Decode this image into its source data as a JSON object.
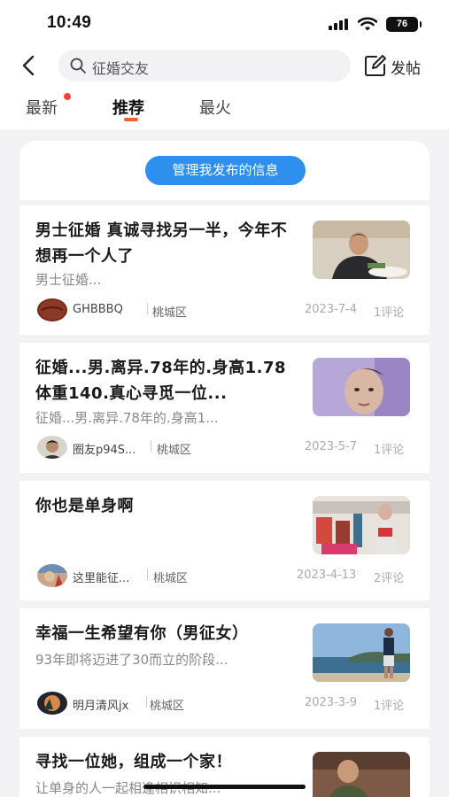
{
  "status_bar": {
    "time": "10:49",
    "battery": "76"
  },
  "header": {
    "search_text": "征婚交友",
    "post_label": "发帖"
  },
  "tabs": [
    {
      "label": "最新",
      "has_dot": true
    },
    {
      "label": "推荐",
      "active": true
    },
    {
      "label": "最火"
    }
  ],
  "manage_button": "管理我发布的信息",
  "posts": [
    {
      "title": "男士征婚 真诚寻找另一半，今年不想再一个人了",
      "excerpt": "男士征婚...",
      "author": "GHBBBQ",
      "district": "桃城区",
      "date": "2023-7-4",
      "comments": "1评论"
    },
    {
      "title": "征婚...男.离异.78年的.身高1.78体重140.真心寻觅一位...",
      "excerpt": "征婚...男.离异.78年的.身高1...",
      "author": "圈友p94S...",
      "district": "桃城区",
      "date": "2023-5-7",
      "comments": "1评论"
    },
    {
      "title": "你也是单身啊",
      "excerpt": "",
      "author": "这里能征...",
      "district": "桃城区",
      "date": "2023-4-13",
      "comments": "2评论"
    },
    {
      "title": "幸福一生希望有你（男征女）",
      "excerpt": "93年即将迈进了30而立的阶段...",
      "author": "明月清风jx",
      "district": "桃城区",
      "date": "2023-3-9",
      "comments": "1评论"
    },
    {
      "title": "寻找一位她，组成一个家！",
      "excerpt": "让单身的人一起相逢相识相知...",
      "author": "",
      "district": "",
      "date": "",
      "comments": ""
    }
  ]
}
